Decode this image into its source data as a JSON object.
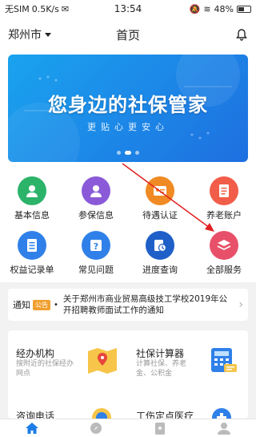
{
  "status_bar": {
    "carrier": "无SIM",
    "speed": "0.5K/s",
    "time": "13:54",
    "battery": "48%"
  },
  "header": {
    "city": "郑州市",
    "title": "首页"
  },
  "banner": {
    "title": "您身边的社保管家",
    "subtitle": "更贴心更安心"
  },
  "services": [
    {
      "label": "基本信息",
      "icon": "user-icon",
      "color": "#2cb36a"
    },
    {
      "label": "参保信息",
      "icon": "person-card-icon",
      "color": "#8a5ad8"
    },
    {
      "label": "待遇认证",
      "icon": "id-card-icon",
      "color": "#f08a24"
    },
    {
      "label": "养老账户",
      "icon": "document-icon",
      "color": "#f25d4a"
    },
    {
      "label": "权益记录单",
      "icon": "list-icon",
      "color": "#2f80e8"
    },
    {
      "label": "常见问题",
      "icon": "question-icon",
      "color": "#2f80e8"
    },
    {
      "label": "进度查询",
      "icon": "clock-icon",
      "color": "#1e5fc8"
    },
    {
      "label": "全部服务",
      "icon": "layers-icon",
      "color": "#e8506a"
    }
  ],
  "notice": {
    "label": "通知",
    "badge": "公告",
    "text": "关于郑州市商业贸易高级技工学校2019年公开招聘教师面试工作的通知"
  },
  "cards": [
    {
      "title": "经办机构",
      "desc": "搜附近的社保经办网点",
      "icon": "map-icon"
    },
    {
      "title": "社保计算器",
      "desc": "计算社保、养老金、公积金",
      "icon": "calculator-icon"
    },
    {
      "title": "咨询电话",
      "desc": "",
      "icon": "phone-icon"
    },
    {
      "title": "工伤定点医疗",
      "desc": "",
      "icon": "hospital-icon"
    }
  ],
  "tabs": [
    {
      "icon": "home-icon",
      "active": true
    },
    {
      "icon": "compass-icon",
      "active": false
    },
    {
      "icon": "bookmark-icon",
      "active": false
    },
    {
      "icon": "profile-icon",
      "active": false
    }
  ],
  "colors": {
    "accent": "#1e7ee8",
    "banner_start": "#1aa3ef",
    "banner_end": "#1e6fe0",
    "pointer": "#e02020"
  }
}
